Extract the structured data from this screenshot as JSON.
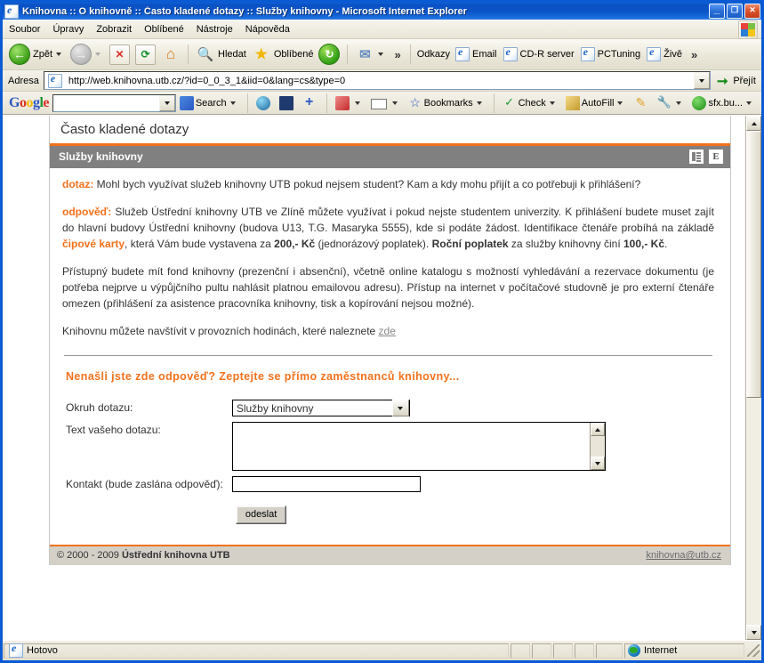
{
  "window": {
    "title": "Knihovna :: O knihovně :: Často kladené dotazy :: Služby knihovny - Microsoft Internet Explorer",
    "minimize_label": "_",
    "maximize_label": "❐",
    "close_label": "✕"
  },
  "menu": {
    "items": [
      {
        "label": "Soubor"
      },
      {
        "label": "Úpravy"
      },
      {
        "label": "Zobrazit"
      },
      {
        "label": "Oblíbené"
      },
      {
        "label": "Nástroje"
      },
      {
        "label": "Nápověda"
      }
    ]
  },
  "toolbar": {
    "back_label": "Zpět",
    "forward_label": "",
    "stop_label": "✕",
    "refresh_label": "⟳",
    "home_label": "⌂",
    "search_label": "Hledat",
    "favorites_label": "Oblíbené",
    "history_label": "",
    "mail_label": "",
    "overflow_label": "»",
    "links_label": "Odkazy",
    "links": [
      {
        "label": "Email"
      },
      {
        "label": "CD-R server"
      },
      {
        "label": "PCTuning"
      },
      {
        "label": "Živě"
      }
    ],
    "links_overflow": "»"
  },
  "address": {
    "label": "Adresa",
    "url": "http://web.knihovna.utb.cz/?id=0_0_3_1&iid=0&lang=cs&type=0",
    "go_label": "Přejít"
  },
  "google_toolbar": {
    "logo": "Google",
    "search_value": "",
    "search_label": "Search",
    "bookmarks_label": "Bookmarks",
    "check_label": "Check",
    "autofill_label": "AutoFill",
    "account_label": "sfx.bu..."
  },
  "page": {
    "title": "Často kladené dotazy",
    "section_bar": "Služby knihovny",
    "section_icons": [
      "print-icon",
      "E"
    ],
    "question_label": "dotaz:",
    "question_text": "Mohl bych využívat služeb knihovny UTB pokud nejsem student? Kam a kdy mohu přijít a co potřebuji k přihlášení?",
    "answer_label": "odpověď:",
    "answer_p1_a": "Služeb Ústřední knihovny UTB ve Zlíně můžete využívat i pokud nejste studentem univerzity. K přihlášení budete muset zajít do hlavní budovy Ústřední knihovny (budova U13, T.G. Masaryka 5555), kde si podáte žádost. Identifikace čtenáře probíhá na základě ",
    "answer_p1_highlight": "čipové karty",
    "answer_p1_b": ", která Vám bude vystavena za ",
    "answer_p1_price1": "200,- Kč",
    "answer_p1_c": " (jednorázový poplatek). ",
    "answer_p1_bold2": "Roční poplatek",
    "answer_p1_d": " za služby knihovny činí ",
    "answer_p1_price2": "100,- Kč",
    "answer_p1_e": ".",
    "answer_p2": "Přístupný budete mít fond knihovny (prezenční i absenční), včetně online katalogu s možností vyhledávání a rezervace dokumentu (je potřeba nejprve u výpůjčního pultu nahlásit platnou emailovou adresu). Přístup na internet v počítačové studovně je pro externí čtenáře omezen (přihlášení za asistence pracovníka knihovny, tisk a kopírování nejsou možné).",
    "answer_p3": "Knihovnu můžete navštívit v provozních hodinách, které naleznete ",
    "answer_p3_link": "zde",
    "ask_heading": "Nenašli jste zde odpověď? Zeptejte se přímo zaměstnanců knihovny...",
    "form": {
      "topic_label": "Okruh dotazu:",
      "topic_value": "Služby knihovny",
      "text_label": "Text vašeho dotazu:",
      "text_value": "",
      "contact_label": "Kontakt (bude zaslána odpověď):",
      "contact_value": "",
      "submit_label": "odeslat"
    },
    "footer": {
      "copyright_prefix": "© 2000 - 2009 ",
      "copyright_org": "Ústřední knihovna UTB",
      "email": "knihovna@utb.cz"
    }
  },
  "statusbar": {
    "status": "Hotovo",
    "zone": "Internet"
  },
  "colors": {
    "accent_orange": "#f2711c",
    "section_gray": "#808080",
    "title_blue": "#0a52c6"
  }
}
